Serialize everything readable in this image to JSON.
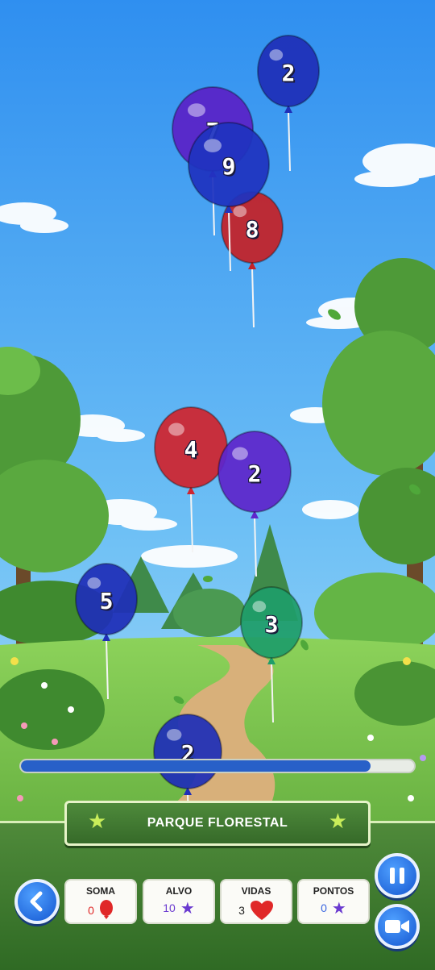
{
  "level": {
    "name": "PARQUE FLORESTAL"
  },
  "balloons": [
    {
      "number": "2",
      "color": "#1f2fb8"
    },
    {
      "number": "7",
      "color": "#5a22c8"
    },
    {
      "number": "9",
      "color": "#1f33c0"
    },
    {
      "number": "8",
      "color": "#c42228"
    },
    {
      "number": "4",
      "color": "#cf2530"
    },
    {
      "number": "2",
      "color": "#5e26cc"
    },
    {
      "number": "5",
      "color": "#1f2fb8"
    },
    {
      "number": "3",
      "color": "#1f9e6a"
    },
    {
      "number": "2",
      "color": "#1f2fb8"
    }
  ],
  "progress": {
    "fraction": 0.89,
    "fill_color": "#2860c8"
  },
  "stats": {
    "soma": {
      "label": "SOMA",
      "value": "0",
      "icon": "red-balloon-icon",
      "color": "#e02828"
    },
    "alvo": {
      "label": "ALVO",
      "value": "10",
      "icon": "purple-star-icon",
      "color": "#6a3ad0"
    },
    "vidas": {
      "label": "VIDAS",
      "value": "3",
      "icon": "red-heart-icon",
      "color": "#e02828"
    },
    "pontos": {
      "label": "PONTOS",
      "value": "0",
      "icon": "purple-star-icon",
      "color": "#3a66e0"
    }
  },
  "controls": {
    "back": {
      "icon": "chevron-left-icon"
    },
    "pause": {
      "icon": "pause-icon"
    },
    "camera": {
      "icon": "video-camera-icon"
    }
  }
}
